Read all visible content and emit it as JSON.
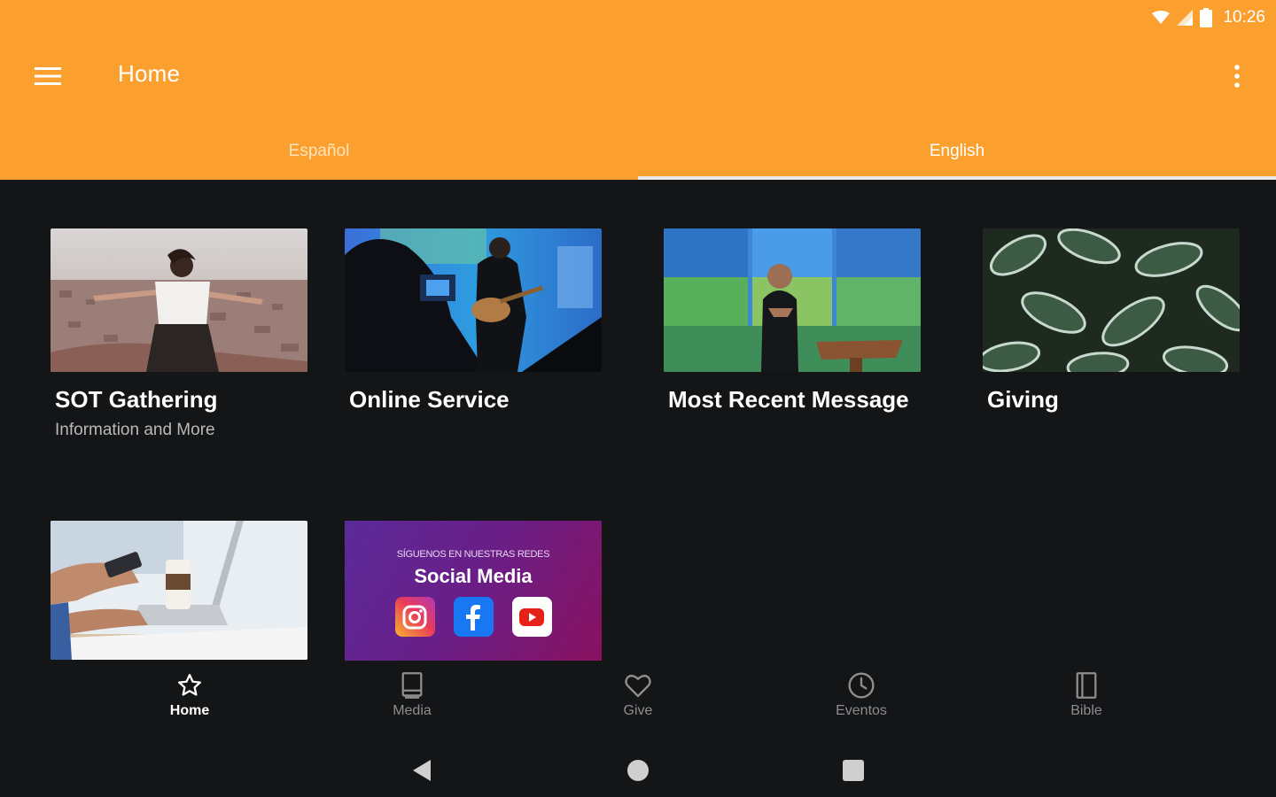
{
  "colors": {
    "app_bar": "#FBA02E",
    "background": "#141517",
    "tab_indicator": "#E8E8E8",
    "nav_inactive": "#8D8D8D"
  },
  "status_bar": {
    "time": "10:26",
    "icons": [
      "wifi-icon",
      "cell-signal-icon",
      "battery-icon"
    ]
  },
  "toolbar": {
    "menu_icon": "hamburger-menu-icon",
    "title": "Home",
    "overflow_icon": "more-vertical-icon"
  },
  "tabs": [
    {
      "label": "Español",
      "active": false
    },
    {
      "label": "English",
      "active": true
    }
  ],
  "cards": [
    {
      "title": "SOT Gathering",
      "subtitle": "Information and More",
      "image": "woman-arms-outstretched-over-city"
    },
    {
      "title": "Online Service",
      "subtitle": "",
      "image": "worship-guitarist-on-stage"
    },
    {
      "title": "Most Recent Message",
      "subtitle": "",
      "image": "preacher-at-pulpit"
    },
    {
      "title": "Giving",
      "subtitle": "",
      "image": "green-leaves-plant"
    },
    {
      "title": "",
      "subtitle": "",
      "image": "hands-on-laptop-with-coffee"
    },
    {
      "title": "",
      "subtitle": "",
      "image": "social-media-banner"
    }
  ],
  "social_banner": {
    "kicker": "SÍGUENOS EN NUESTRAS REDES",
    "title": "Social Media",
    "icons": [
      "instagram-icon",
      "facebook-icon",
      "youtube-icon"
    ]
  },
  "bottom_nav": [
    {
      "label": "Home",
      "icon": "star-icon",
      "active": true
    },
    {
      "label": "Media",
      "icon": "book-icon",
      "active": false
    },
    {
      "label": "Give",
      "icon": "heart-icon",
      "active": false
    },
    {
      "label": "Eventos",
      "icon": "clock-icon",
      "active": false
    },
    {
      "label": "Bible",
      "icon": "bible-icon",
      "active": false
    }
  ],
  "system_nav": [
    "back-icon",
    "home-circle-icon",
    "recents-icon"
  ]
}
